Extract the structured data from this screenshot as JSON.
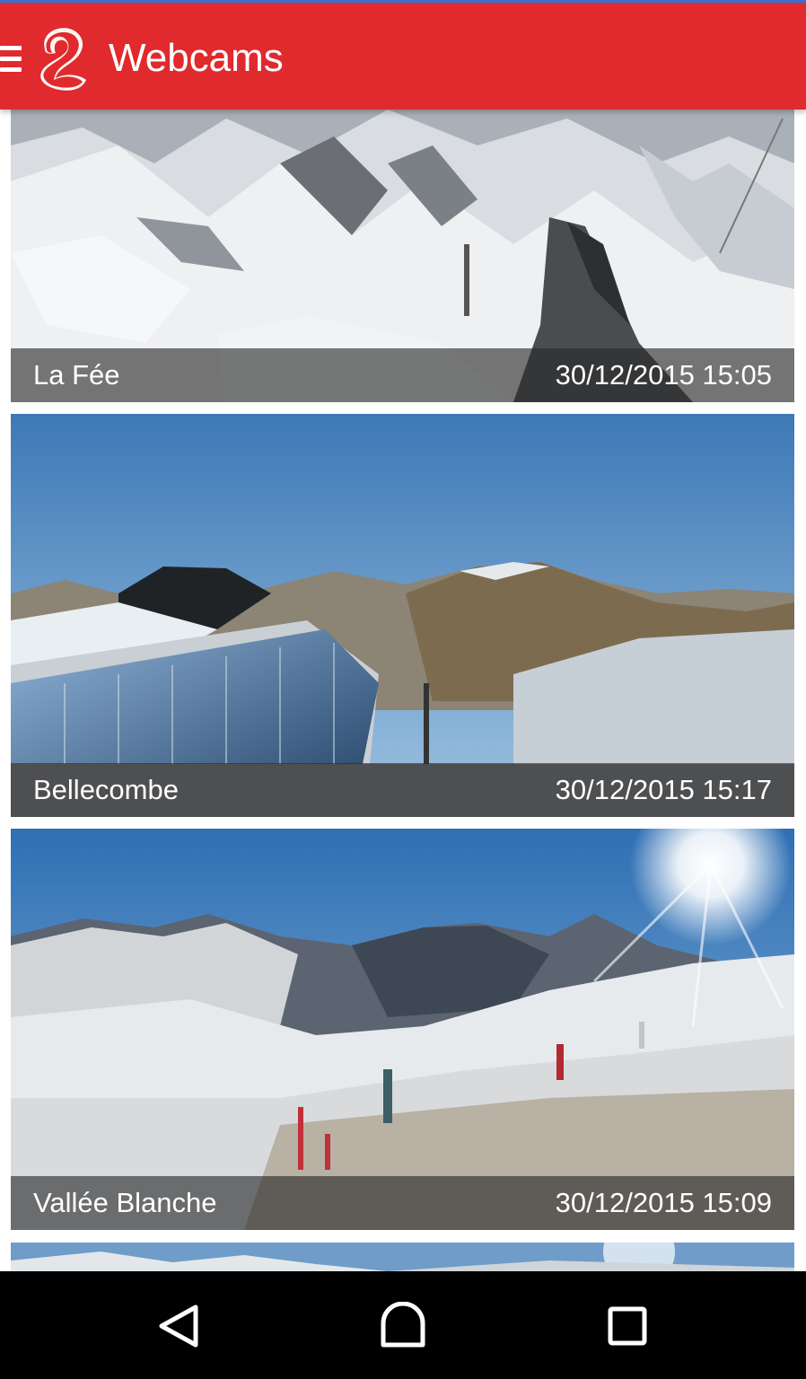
{
  "app_bar": {
    "title": "Webcams",
    "menu_icon": "hamburger-menu-icon",
    "logo_icon": "resort-logo-icon",
    "color": "#e02a2d"
  },
  "webcams": [
    {
      "name": "La Fée",
      "timestamp": "30/12/2015 15:05"
    },
    {
      "name": "Bellecombe",
      "timestamp": "30/12/2015 15:17"
    },
    {
      "name": "Vallée Blanche",
      "timestamp": "30/12/2015 15:09"
    }
  ],
  "nav_bar": {
    "back_icon": "back-triangle-icon",
    "home_icon": "home-icon",
    "recents_icon": "recents-square-icon"
  }
}
